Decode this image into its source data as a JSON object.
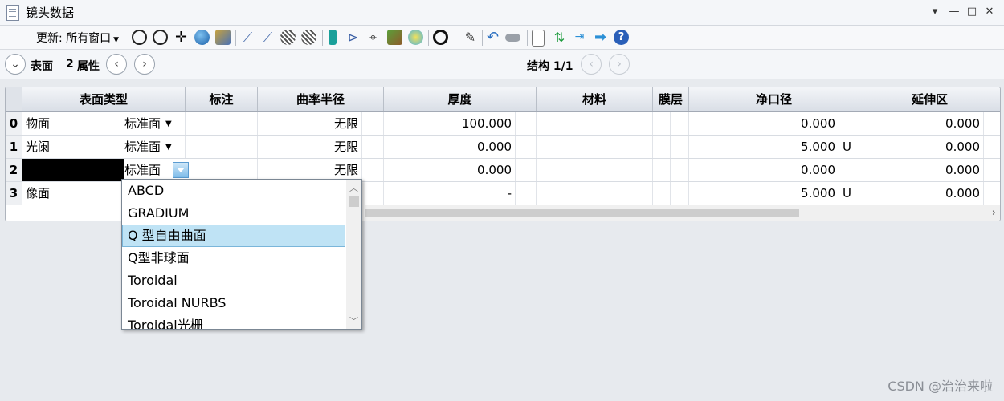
{
  "window": {
    "title": "镜头数据",
    "controls": [
      "▾",
      "—",
      "□",
      "✕"
    ]
  },
  "toolbar": {
    "update_label": "更新: 所有窗口",
    "icons": [
      "reload-icon",
      "auto-update-icon",
      "move-cross-icon",
      "globe-icon",
      "image-icon",
      "ray-aim-icon",
      "ray-cancel-icon",
      "glass-icon",
      "glass-remove-icon",
      "lens-icon",
      "merit-icon",
      "tolerance-icon",
      "optimize-icon",
      "color-map-icon",
      "circle-icon",
      "edit-pen-icon",
      "undo-arrow-icon",
      "toggle-icon",
      "notes-icon",
      "swap-icon",
      "collapse-icon",
      "arrow-right-icon",
      "help-icon"
    ]
  },
  "navbar": {
    "surface_label": "表面",
    "surface_num": "2",
    "properties_label": "属性",
    "config_label": "结构 1/1"
  },
  "grid": {
    "headers": [
      "表面类型",
      "标注",
      "曲率半径",
      "厚度",
      "材料",
      "膜层",
      "净口径",
      "延伸区"
    ],
    "rows": [
      {
        "num": "0",
        "name": "物面",
        "type": "标准面",
        "radius": "无限",
        "thickness": "100.000",
        "aperture": "0.000",
        "aperture_flag": "",
        "extension": "0.000"
      },
      {
        "num": "1",
        "name": "光阑",
        "type": "标准面",
        "radius": "无限",
        "thickness": "0.000",
        "aperture": "5.000",
        "aperture_flag": "U",
        "extension": "0.000"
      },
      {
        "num": "2",
        "name": "",
        "type": "标准面",
        "radius": "无限",
        "thickness": "0.000",
        "aperture": "0.000",
        "aperture_flag": "",
        "extension": "0.000"
      },
      {
        "num": "3",
        "name": "像面",
        "type": "",
        "radius": "",
        "thickness": "-",
        "aperture": "5.000",
        "aperture_flag": "U",
        "extension": "0.000"
      }
    ]
  },
  "dropdown": {
    "options": [
      "ABCD",
      "GRADIUM",
      "Q 型自由曲面",
      "Q型非球面",
      "Toroidal",
      "Toroidal NURBS",
      "Toroidal光栅"
    ],
    "highlighted": "Q 型自由曲面"
  },
  "watermark": "CSDN @治治来啦"
}
